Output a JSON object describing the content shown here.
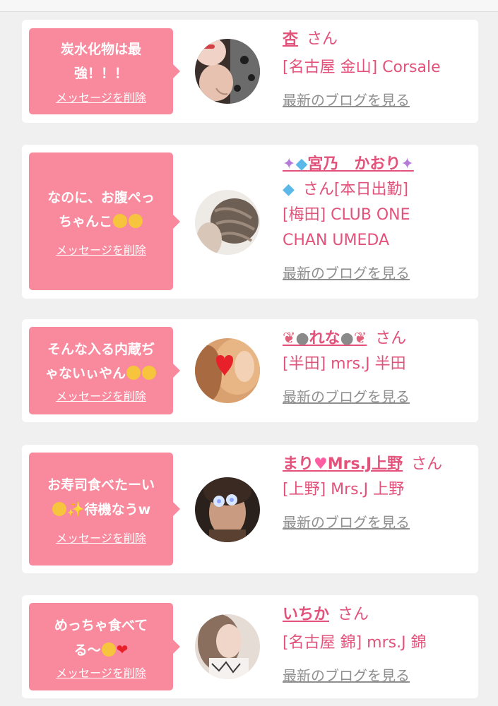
{
  "cards": [
    {
      "message": "炭水化物は最強！！！",
      "message_lines": [
        "炭水化物は最",
        "強！！！"
      ],
      "delete_label": "メッセージを削除",
      "name": "杏",
      "honorific": "さん",
      "shop": "[名古屋 金山] Corsale",
      "blog_link": "最新のブログを見る"
    },
    {
      "message_lines": [
        "なのに、お腹ぺっ",
        "ちゃんこ"
      ],
      "message_emojis": [
        "thinking-face",
        "heart-eyes-face"
      ],
      "delete_label": "メッセージを削除",
      "name": "🦄💎宮乃　かおり🦄💎",
      "name_text": "宮乃　かおり",
      "honorific": "さん[本日出勤]",
      "shop_lines": [
        "[梅田] CLUB ONE",
        "CHAN UMEDA"
      ],
      "blog_link": "最新のブログを見る"
    },
    {
      "message_lines": [
        "そんな入る内蔵ぢ",
        "ゃないぃやん"
      ],
      "message_emojis": [
        "rolling-laughing-face",
        "rolling-laughing-face"
      ],
      "delete_label": "メッセージを削除",
      "name": "🎀🐰れな🐰🎀",
      "name_text": "れな",
      "honorific": "さん",
      "shop": "[半田] mrs.J 半田",
      "blog_link": "最新のブログを見る"
    },
    {
      "message_lines": [
        "お寿司食べたーい",
        "待機なうw"
      ],
      "message_emojis": [
        "smiling-face",
        "sparkles"
      ],
      "delete_label": "メッセージを削除",
      "name": "まり💕Mrs.J上野",
      "name_text": "まり",
      "name_suffix": "Mrs.J上野",
      "honorific": "さん",
      "shop": "[上野] Mrs.J 上野",
      "blog_link": "最新のブログを見る"
    },
    {
      "message_lines": [
        "めっちゃ食べて",
        "る〜"
      ],
      "message_emojis": [
        "grinning-squint-face",
        "red-heart"
      ],
      "delete_label": "メッセージを削除",
      "name": "いちか",
      "honorific": "さん",
      "shop": "[名古屋 錦] mrs.J 錦",
      "blog_link": "最新のブログを見る"
    }
  ],
  "colors": {
    "bubble": "#f9899c",
    "accent": "#e2527a",
    "link_gray": "#8f8f8f",
    "background": "#f0f0f1"
  }
}
